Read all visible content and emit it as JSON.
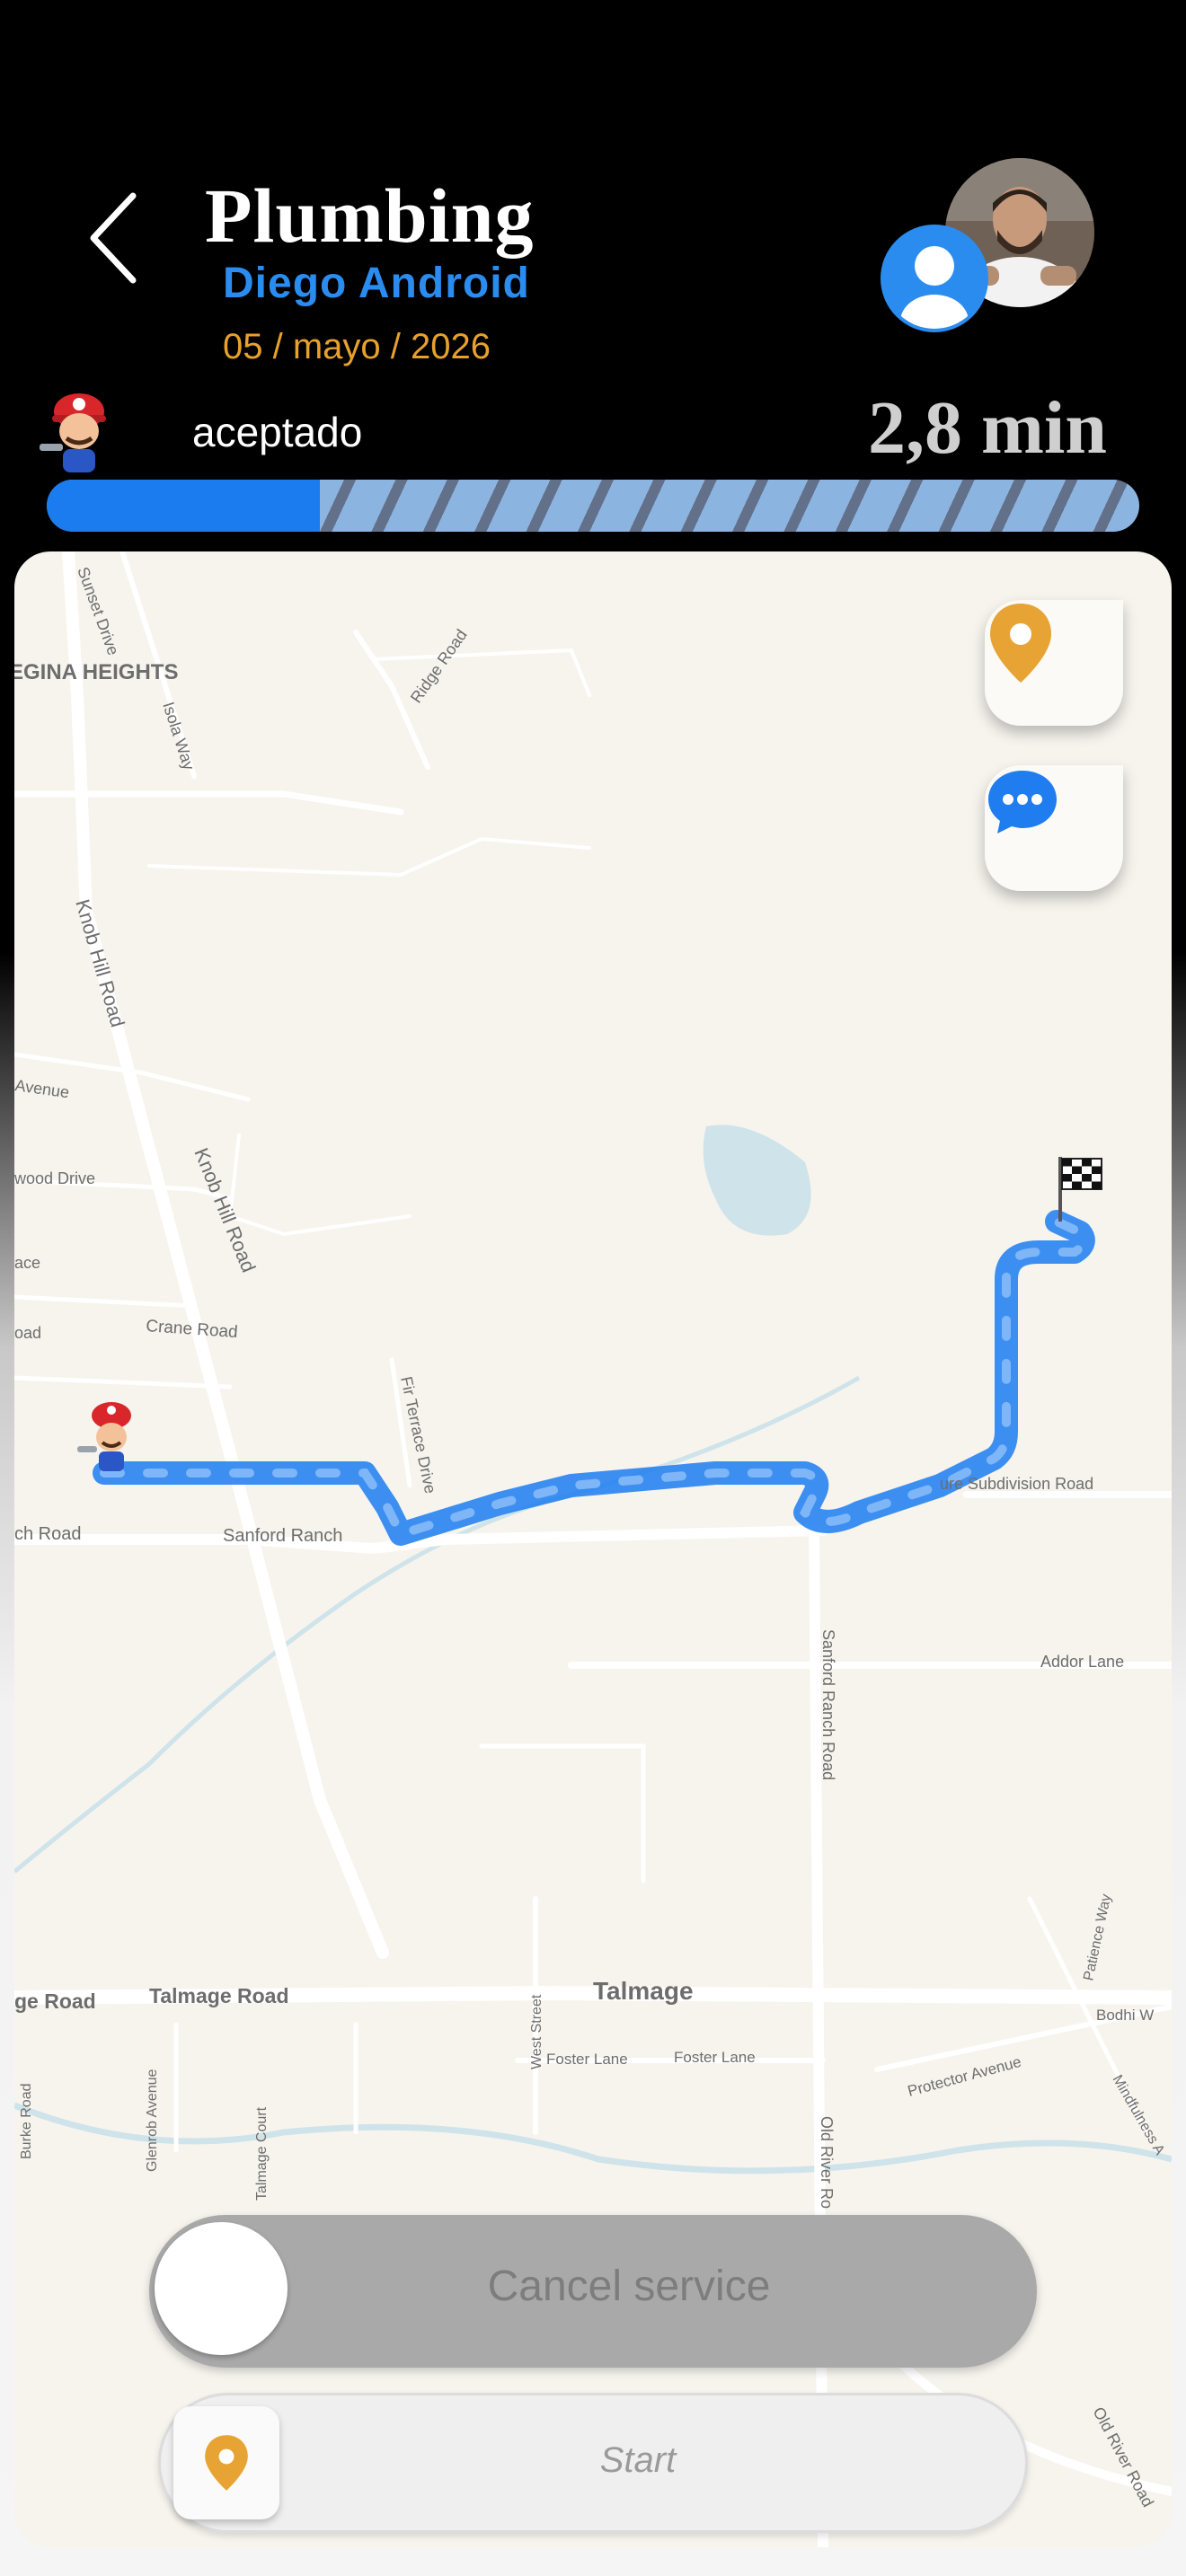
{
  "header": {
    "title": "Plumbing",
    "subtitle": "Diego Android",
    "date": "05 / mayo / 2026"
  },
  "status": {
    "label": "aceptado",
    "eta": "2,8 min",
    "progress_fraction": 0.25
  },
  "map": {
    "labels": {
      "neighborhood": "EGINA HEIGHTS",
      "sunset": "Sunset Drive",
      "ridge": "Ridge Road",
      "isola": "Isola Way",
      "knob1": "Knob Hill Road",
      "knob2": "Knob Hill Road",
      "avenue": "Avenue",
      "wood": "wood Drive",
      "ace": "ace",
      "oad": "oad",
      "crane": "Crane Road",
      "fir": "Fir Terrace Drive",
      "chroad": "ch Road",
      "sanford1": "Sanford Ranch",
      "subdivision": "ure Subdivision Road",
      "sanford2": "Sanford Ranch Road",
      "addor": "Addor Lane",
      "town": "Talmage",
      "ge_road": "ge Road",
      "talmage_road": "Talmage Road",
      "burke": "Burke Road",
      "glenrob": "Glenrob Avenue",
      "talmage_court": "Talmage Court",
      "west": "West Street",
      "foster1": "Foster Lane",
      "foster2": "Foster Lane",
      "old_river1": "Old River Ro",
      "old_river2": "Old River Road",
      "patience": "Patience Way",
      "bodhi": "Bodhi W",
      "protector": "Protector Avenue",
      "mindfulness": "Mindfulness A"
    }
  },
  "actions": {
    "location_icon": "location-pin-icon",
    "chat_icon": "chat-bubble-icon",
    "cancel_label": "Cancel service",
    "start_label": "Start"
  },
  "colors": {
    "accent_blue": "#2b8cf0",
    "date_orange": "#e7a12c",
    "route_blue": "#1b7cf0"
  }
}
